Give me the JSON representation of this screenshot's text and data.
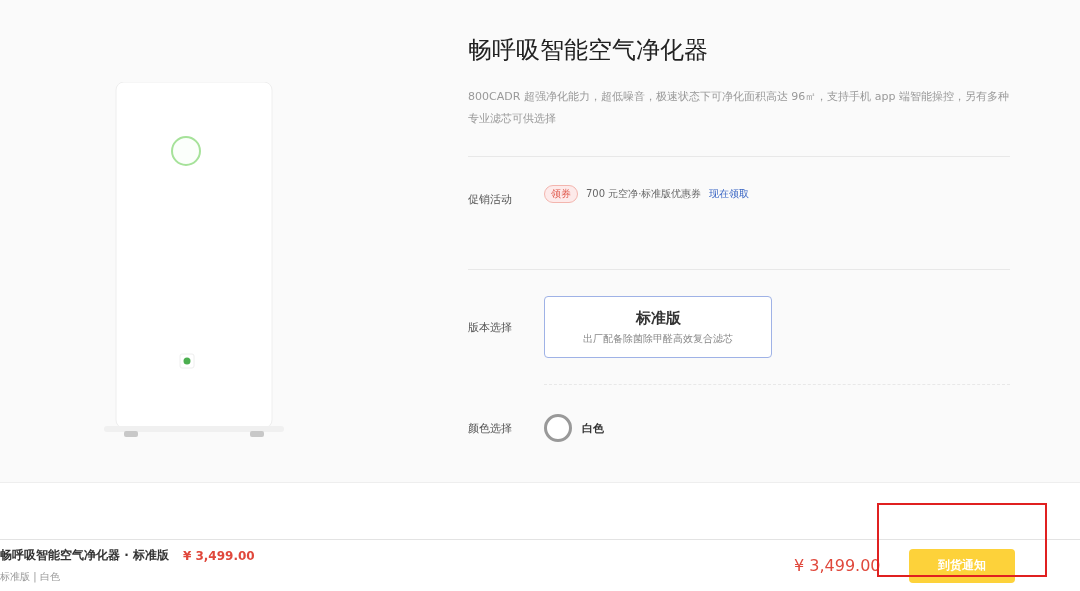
{
  "product": {
    "title": "畅呼吸智能空气净化器",
    "description": "800CADR 超强净化能力，超低噪音，极速状态下可净化面积高达 96㎡，支持手机 app 端智能操控，另有多种专业滤芯可供选择"
  },
  "promotion": {
    "label": "促销活动",
    "badge": "领券",
    "text": "700 元空净·标准版优惠券",
    "link": "现在领取"
  },
  "versions": {
    "label": "版本选择",
    "options": [
      {
        "name": "标准版",
        "detail": "出厂配备除菌除甲醛高效复合滤芯",
        "selected": true
      }
    ]
  },
  "colors": {
    "label": "颜色选择",
    "options": [
      {
        "name": "白色"
      }
    ]
  },
  "bottom_bar": {
    "product_name": "畅呼吸智能空气净化器 · 标准版",
    "price": "¥ 3,499.00",
    "spec": "标准版 | 白色",
    "total": "¥ 3,499.00",
    "button": "到货通知",
    "highlighted": true
  }
}
